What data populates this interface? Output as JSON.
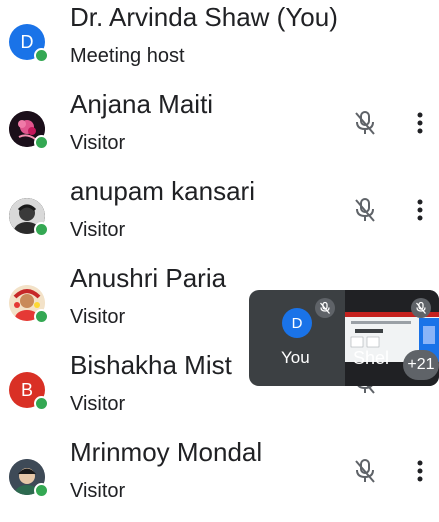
{
  "colors": {
    "host_avatar": "#1a73e8",
    "bishakha_avatar": "#d93025",
    "online_dot": "#34a853",
    "text": "#202124",
    "pip_bg": "#3c4043"
  },
  "participants": [
    {
      "name": "Dr. Arvinda Shaw (You)",
      "role": "Meeting host",
      "avatar_letter": "D",
      "avatar": "letter-avatar",
      "muted": false
    },
    {
      "name": "Anjana Maiti",
      "role": "Visitor",
      "avatar": "photo-avatar",
      "muted": true
    },
    {
      "name": "anupam kansari",
      "role": "Visitor",
      "avatar": "photo-avatar",
      "muted": true
    },
    {
      "name": "Anushri Paria",
      "role": "Visitor",
      "avatar": "photo-avatar",
      "muted": true
    },
    {
      "name": "Bishakha Mist",
      "role": "Visitor",
      "avatar_letter": "B",
      "avatar": "letter-avatar",
      "muted": true
    },
    {
      "name": "Mrinmoy Mondal",
      "role": "Visitor",
      "avatar": "photo-avatar",
      "muted": true
    }
  ],
  "pip": {
    "self_letter": "D",
    "self_label": "You",
    "share_label": "Shel",
    "more_count": "+21"
  },
  "icons": {
    "mic_off": "mic-off-icon",
    "more": "more-vert-icon"
  }
}
